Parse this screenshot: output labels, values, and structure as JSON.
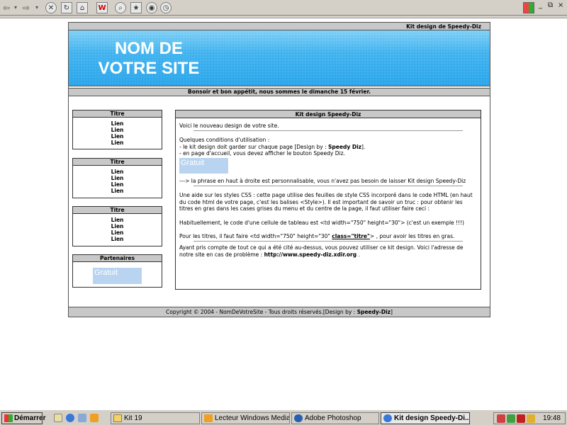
{
  "toolbar": {
    "back_icon": "back-arrow-icon",
    "forward_icon": "forward-arrow-icon",
    "window_controls": [
      "_",
      "⧉",
      "×"
    ]
  },
  "page": {
    "top_bar": "Kit design de Speedy-Diz",
    "site_title_line1": "NOM DE",
    "site_title_line2": "VOTRE SITE",
    "greeting": "Bonsoir et bon appétit, nous sommes le dimanche 15 février.",
    "sidebar": [
      {
        "title": "Titre",
        "links": [
          "Lien",
          "Lien",
          "Lien",
          "Lien"
        ]
      },
      {
        "title": "Titre",
        "links": [
          "Lien",
          "Lien",
          "Lien",
          "Lien"
        ]
      },
      {
        "title": "Titre",
        "links": [
          "Lien",
          "Lien",
          "Lien",
          "Lien"
        ]
      }
    ],
    "partners": {
      "title": "Partenaires",
      "badge": "Gratuit"
    },
    "main": {
      "title": "Kit design Speedy-Diz",
      "intro": "Voici le nouveau design de votre site.",
      "conditions_heading": "Quelques conditions d'utilisation :",
      "cond1_prefix": "- le kit design doit garder sur chaque page [Design by : ",
      "cond1_bold": "Speedy Diz",
      "cond1_suffix": "].",
      "cond2": "- en page d'accueil, vous devez afficher le bouton Speedy Diz.",
      "badge": "Gratuit",
      "phrase_note": "---> la phrase en haut à droite est personnalisable, vous n'avez pas besoin de laisser Kit design Speedy-Diz",
      "css_help": "Une aide sur les styles CSS : cette page utilise des feuilles de style CSS incorporé dans le code HTML (en haut du code html de votre page, c'est les balises <Style>). Il est important de savoir un truc : pour obtenir les titres en gras dans les cases grises du menu et du centre de la page, il faut utiliser faire ceci :",
      "cell_code": "Habituellement, le code d'une cellule de tableau est <td width=\"750\" height=\"30\"> (c'est un exemple !!!)",
      "titles_prefix": "Pour les titres, il faut faire <td width=\"750\" height=\"30\" ",
      "titles_class": "class=\"titre\"",
      "titles_suffix": "> , pour avoir les titres en gras.",
      "closing_prefix": "Ayant pris compte de tout ce qui a été cité au-dessus, vous pouvez utiliser ce kit design. Voici l'adresse de notre site en cas de problème : ",
      "closing_url": "http://www.speedy-diz.xdir.org",
      "closing_suffix": " ."
    },
    "footer_prefix": "Copyright © 2004 - NomDeVotreSite - Tous droits réservés.[Design by : ",
    "footer_bold": "Speedy-Diz",
    "footer_suffix": "]"
  },
  "taskbar": {
    "start": "Démarrer",
    "tasks": [
      {
        "label": "Kit 19",
        "icon": "folder-icon"
      },
      {
        "label": "Lecteur Windows Media",
        "icon": "media-player-icon"
      },
      {
        "label": "Adobe Photoshop",
        "icon": "photoshop-icon"
      },
      {
        "label": "Kit design Speedy-Di...",
        "icon": "browser-icon",
        "active": true
      }
    ],
    "clock": "19:48"
  }
}
